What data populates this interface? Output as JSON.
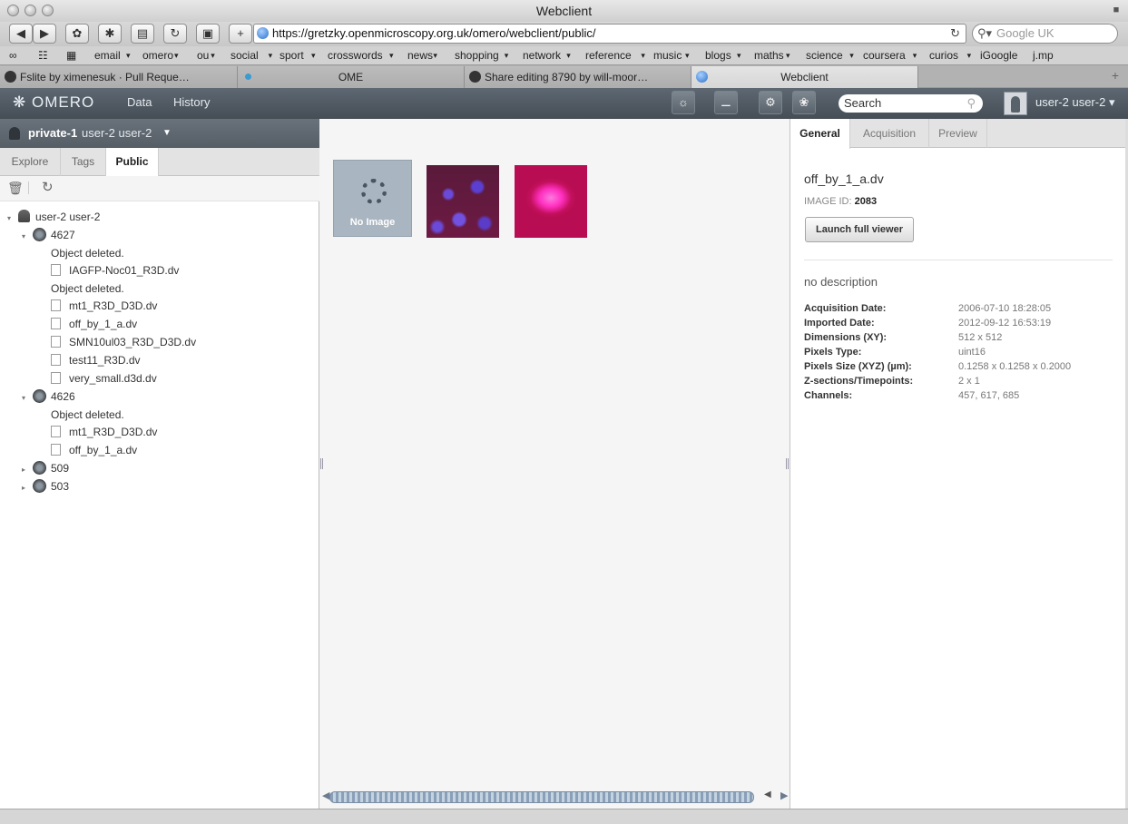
{
  "window": {
    "title": "Webclient"
  },
  "browser": {
    "url": "https://gretzky.openmicroscopy.org.uk/omero/webclient/public/",
    "search_placeholder": "Google UK",
    "bookmarks": [
      "email",
      "omero",
      "ou",
      "social",
      "sport",
      "crosswords",
      "news",
      "shopping",
      "network",
      "reference",
      "music",
      "blogs",
      "maths",
      "science",
      "coursera",
      "curios",
      "iGoogle",
      "j.mp"
    ],
    "tabs": [
      {
        "label": "Fslite by ximenesuk · Pull Reque…",
        "icon": "github-icon"
      },
      {
        "label": "OME",
        "icon": "ome-icon"
      },
      {
        "label": "Share editing 8790 by will-moor…",
        "icon": "github-icon"
      },
      {
        "label": "Webclient",
        "icon": "globe-icon"
      }
    ]
  },
  "header": {
    "logo": "OMERO",
    "nav": [
      "Data",
      "History"
    ],
    "search_placeholder": "Search",
    "user": "user-2 user-2"
  },
  "left": {
    "group": "private-1",
    "group_user": "user-2 user-2",
    "tabs": [
      "Explore",
      "Tags",
      "Public"
    ],
    "tree": {
      "root": "user-2 user-2",
      "shares": [
        {
          "id": "4627",
          "items": [
            "Object deleted.",
            "IAGFP-Noc01_R3D.dv",
            "Object deleted.",
            "mt1_R3D_D3D.dv",
            "off_by_1_a.dv",
            "SMN10ul03_R3D_D3D.dv",
            "test11_R3D.dv",
            "very_small.d3d.dv"
          ]
        },
        {
          "id": "4626",
          "items": [
            "Object deleted.",
            "mt1_R3D_D3D.dv",
            "off_by_1_a.dv"
          ]
        },
        {
          "id": "509",
          "items": []
        },
        {
          "id": "503",
          "items": []
        }
      ]
    }
  },
  "center": {
    "no_image": "No Image"
  },
  "right": {
    "tabs": [
      "General",
      "Acquisition",
      "Preview"
    ],
    "name": "off_by_1_a.dv",
    "image_id_label": "IMAGE ID:",
    "image_id": "2083",
    "launch": "Launch full viewer",
    "description": "no description",
    "meta": [
      {
        "k": "Acquisition Date:",
        "v": "2006-07-10 18:28:05"
      },
      {
        "k": "Imported Date:",
        "v": "2012-09-12 16:53:19"
      },
      {
        "k": "Dimensions (XY):",
        "v": "512 x 512"
      },
      {
        "k": "Pixels Type:",
        "v": "uint16"
      },
      {
        "k": "Pixels Size (XYZ) (µm):",
        "v": "0.1258 x 0.1258 x 0.2000"
      },
      {
        "k": "Z-sections/Timepoints:",
        "v": "2 x 1"
      },
      {
        "k": "Channels:",
        "v": "457, 617, 685"
      }
    ]
  }
}
